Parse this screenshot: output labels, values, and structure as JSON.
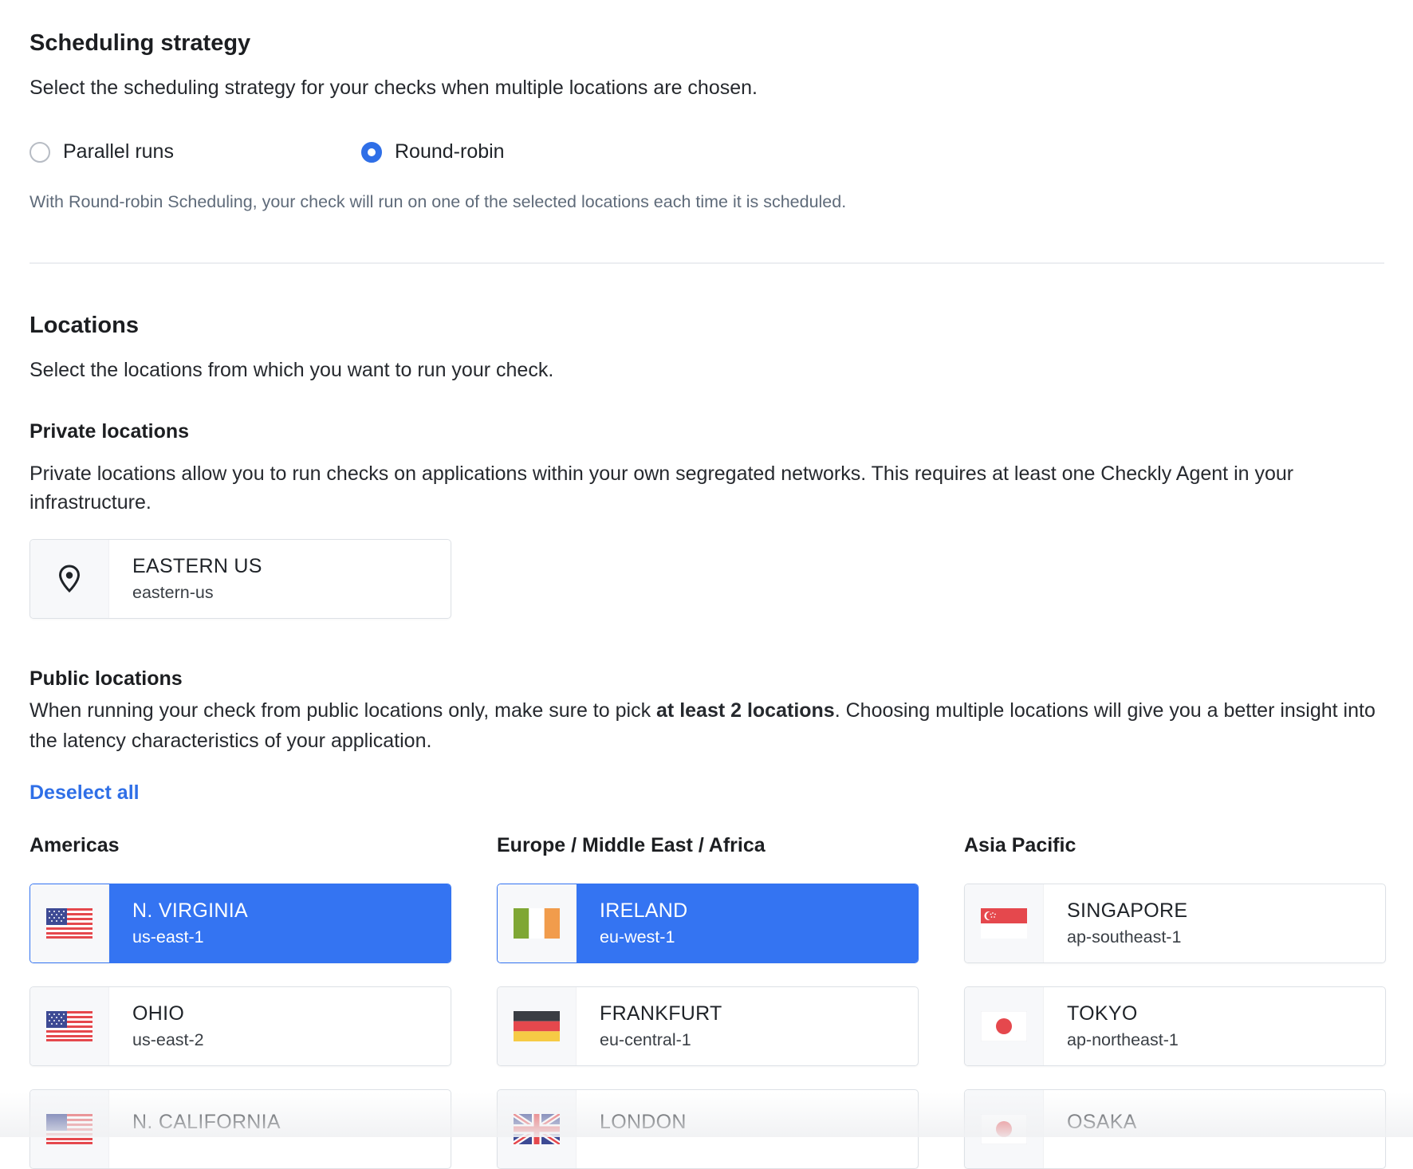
{
  "scheduling": {
    "title": "Scheduling strategy",
    "description": "Select the scheduling strategy for your checks when multiple locations are chosen.",
    "options": [
      {
        "label": "Parallel runs",
        "checked": false
      },
      {
        "label": "Round-robin",
        "checked": true
      }
    ],
    "hint": "With Round-robin Scheduling, your check will run on one of the selected locations each time it is scheduled."
  },
  "locations": {
    "title": "Locations",
    "description": "Select the locations from which you want to run your check.",
    "private": {
      "title": "Private locations",
      "description": "Private locations allow you to run checks on applications within your own segregated networks. This requires at least one Checkly Agent in your infrastructure.",
      "items": [
        {
          "name": "EASTERN US",
          "code": "eastern-us",
          "icon": "map-pin-icon"
        }
      ]
    },
    "public": {
      "title": "Public locations",
      "description_before": "When running your check from public locations only, make sure to pick ",
      "description_bold": "at least 2 locations",
      "description_after": ". Choosing multiple locations will give you a better insight into the latency characteristics of your application.",
      "deselect_all": "Deselect all",
      "regions": [
        {
          "title": "Americas",
          "items": [
            {
              "name": "N. VIRGINIA",
              "code": "us-east-1",
              "flag": "us-flag-icon",
              "selected": true
            },
            {
              "name": "OHIO",
              "code": "us-east-2",
              "flag": "us-flag-icon",
              "selected": false
            },
            {
              "name": "N. CALIFORNIA",
              "code": "",
              "flag": "us-flag-icon",
              "selected": false
            }
          ]
        },
        {
          "title": "Europe / Middle East / Africa",
          "items": [
            {
              "name": "IRELAND",
              "code": "eu-west-1",
              "flag": "ireland-flag-icon",
              "selected": true
            },
            {
              "name": "FRANKFURT",
              "code": "eu-central-1",
              "flag": "germany-flag-icon",
              "selected": false
            },
            {
              "name": "LONDON",
              "code": "",
              "flag": "uk-flag-icon",
              "selected": false
            }
          ]
        },
        {
          "title": "Asia Pacific",
          "items": [
            {
              "name": "SINGAPORE",
              "code": "ap-southeast-1",
              "flag": "singapore-flag-icon",
              "selected": false
            },
            {
              "name": "TOKYO",
              "code": "ap-northeast-1",
              "flag": "japan-flag-icon",
              "selected": false
            },
            {
              "name": "OSAKA",
              "code": "",
              "flag": "japan-flag-icon",
              "selected": false
            }
          ]
        }
      ]
    }
  },
  "colors": {
    "accent": "#3474f2",
    "link": "#2f6fe7",
    "muted_text": "#5f6b7a"
  }
}
